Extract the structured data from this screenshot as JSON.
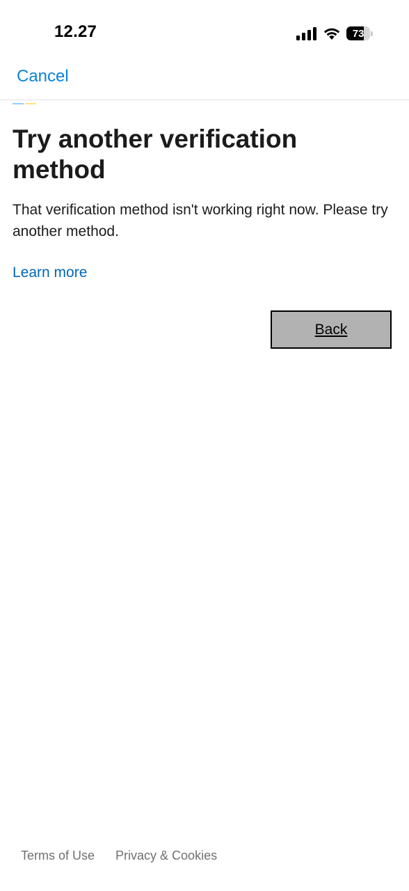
{
  "status_bar": {
    "time": "12.27",
    "battery_level": "73",
    "battery_fraction": 0.73,
    "icons": [
      "signal-icon",
      "wifi-icon",
      "battery-icon"
    ]
  },
  "nav": {
    "cancel_label": "Cancel"
  },
  "progress": {
    "colors": [
      "#8fd3f4",
      "#ffe27a"
    ]
  },
  "main": {
    "title": "Try another verification method",
    "description": "That verification method isn't working right now. Please try another method.",
    "learn_more_label": "Learn more",
    "back_label": "Back"
  },
  "footer": {
    "terms_label": "Terms of Use",
    "privacy_label": "Privacy & Cookies"
  },
  "colors": {
    "link": "#0067b8",
    "cancel": "#0a84d6",
    "button_bg": "#b2b2b2",
    "footer_text": "#707070"
  }
}
